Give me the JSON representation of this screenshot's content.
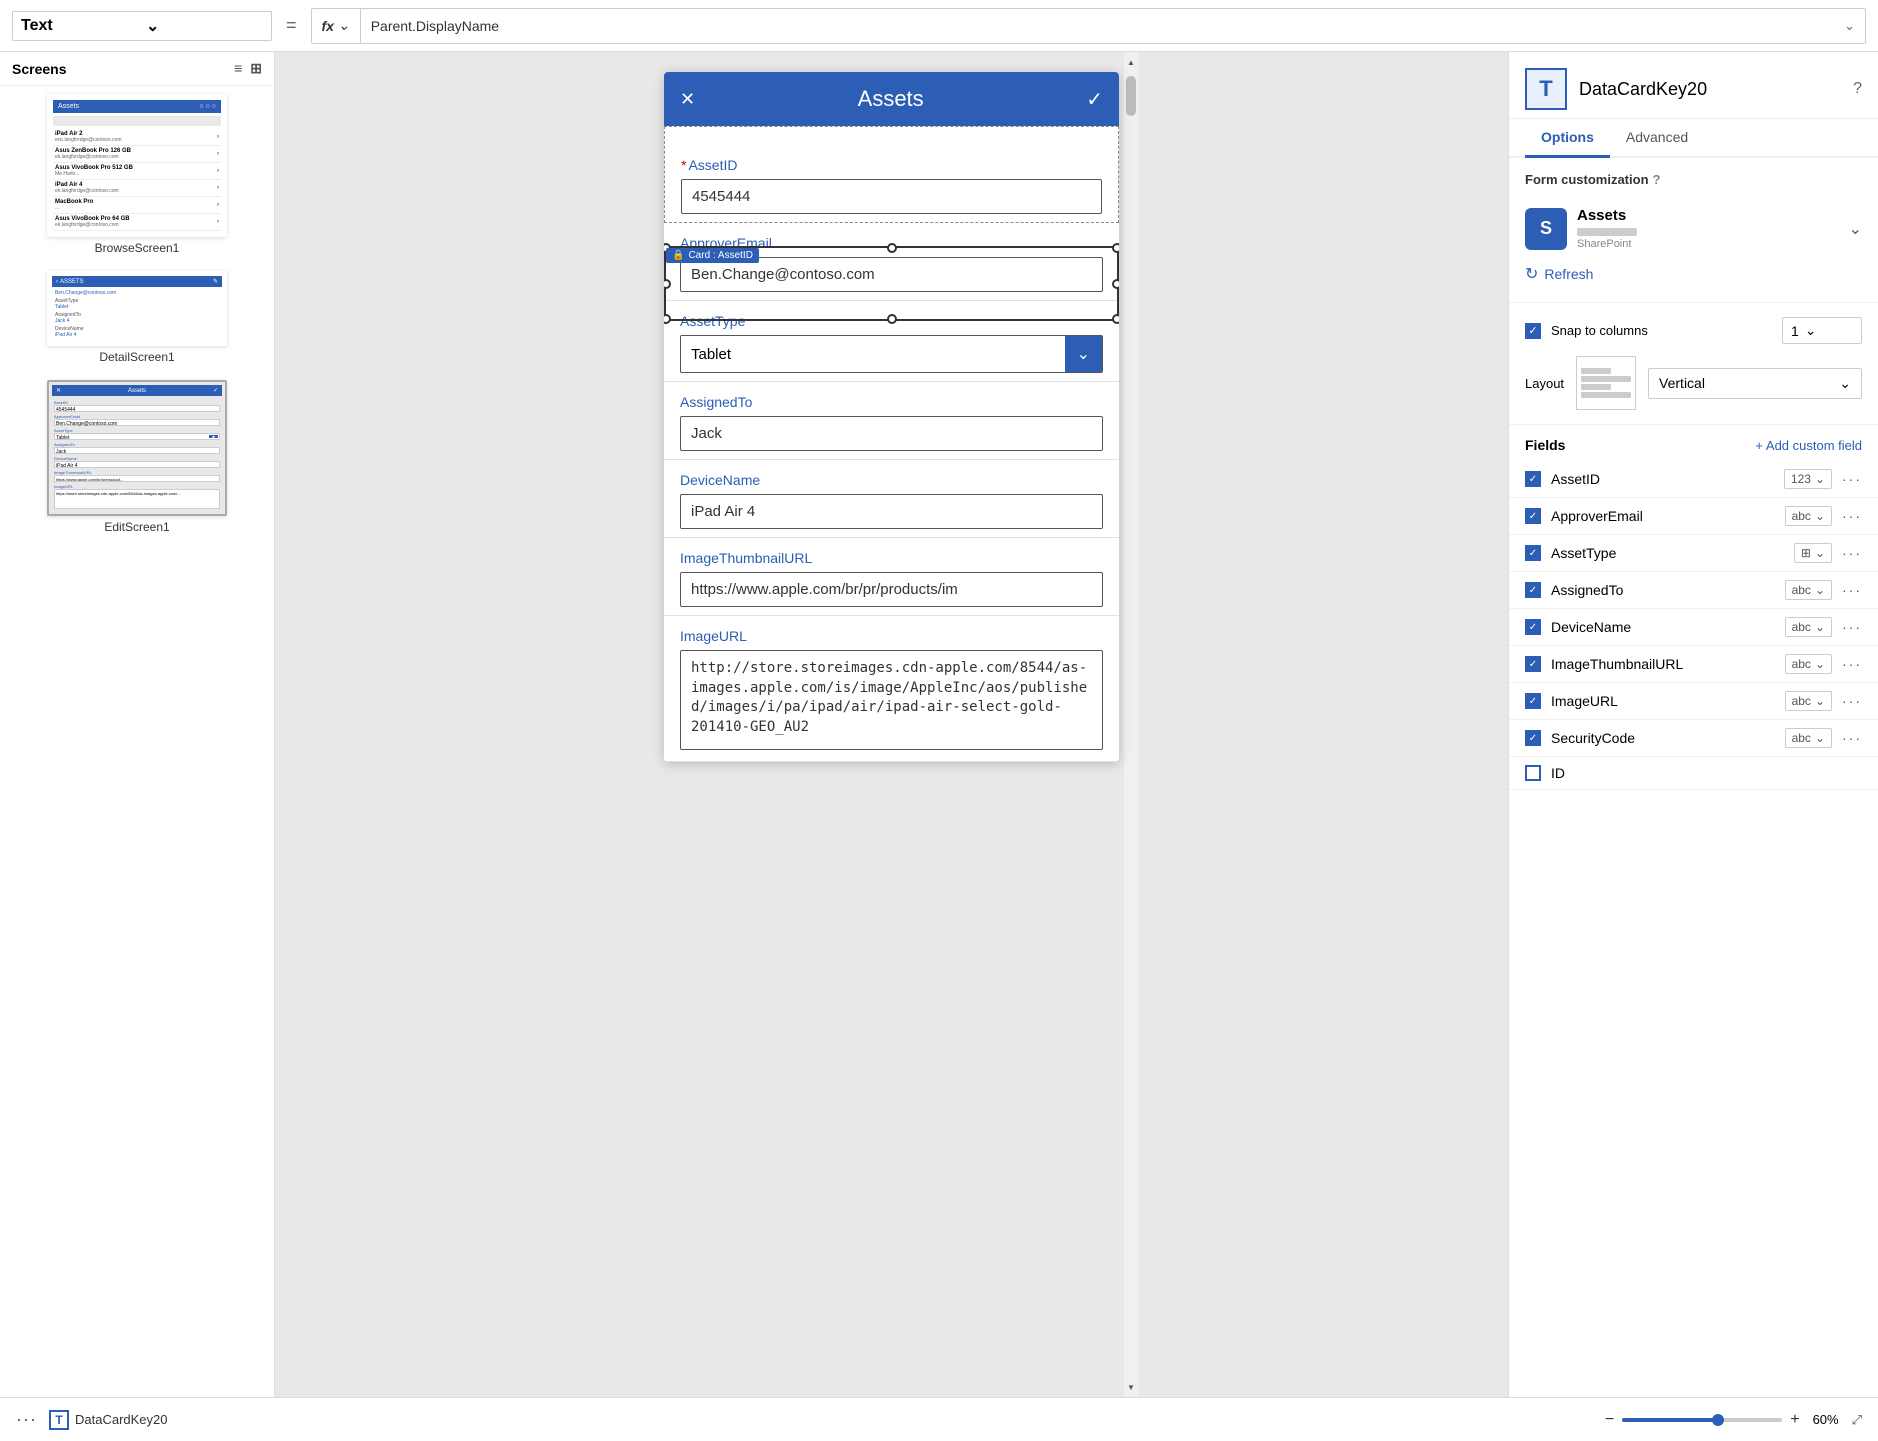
{
  "toolbar": {
    "dropdown_label": "Text",
    "equals_sign": "=",
    "fx_symbol": "fx",
    "formula": "Parent.DisplayName",
    "chevron": "⌄"
  },
  "screens_panel": {
    "title": "Screens",
    "items": [
      {
        "label": "BrowseScreen1"
      },
      {
        "label": "DetailScreen1"
      },
      {
        "label": "EditScreen1"
      }
    ]
  },
  "phone": {
    "header_title": "Assets",
    "close_icon": "✕",
    "check_icon": "✓",
    "card_badge": "Card : AssetID",
    "lock_icon": "🔒",
    "fields": [
      {
        "label": "AssetID",
        "required": true,
        "value": "4545444",
        "type": "text"
      },
      {
        "label": "ApproverEmail",
        "required": false,
        "value": "Ben.Change@contoso.com",
        "type": "text"
      },
      {
        "label": "AssetType",
        "required": false,
        "value": "Tablet",
        "type": "dropdown"
      },
      {
        "label": "AssignedTo",
        "required": false,
        "value": "Jack",
        "type": "text"
      },
      {
        "label": "DeviceName",
        "required": false,
        "value": "iPad Air 4",
        "type": "text"
      },
      {
        "label": "ImageThumbnailURL",
        "required": false,
        "value": "https://www.apple.com/br/pr/products/im",
        "type": "text"
      },
      {
        "label": "ImageURL",
        "required": false,
        "value": "http://store.storeimages.cdn-apple.com/8544/as-images.apple.com/is/image/AppleInc/aos/published/images/i/pa/ipad/air/ipad-air-select-gold-201410-GEO_AU2",
        "type": "textarea"
      }
    ]
  },
  "right_panel": {
    "title": "DataCardKey20",
    "help_icon": "?",
    "tabs": [
      "Options",
      "Advanced"
    ],
    "active_tab": "Options",
    "form_customization_label": "Form customization",
    "data_source": {
      "name": "Assets",
      "sub": "SharePoint",
      "icon_letter": "S"
    },
    "refresh_label": "Refresh",
    "snap_to_columns_label": "Snap to columns",
    "columns_value": "1",
    "layout_label": "Layout",
    "layout_value": "Vertical",
    "fields_title": "Fields",
    "add_custom_field_label": "+ Add custom field",
    "fields": [
      {
        "name": "AssetID",
        "checked": true,
        "type_icon": "123",
        "has_chevron": true
      },
      {
        "name": "ApproverEmail",
        "checked": true,
        "type_icon": "abc",
        "has_chevron": true
      },
      {
        "name": "AssetType",
        "checked": true,
        "type_icon": "⊞",
        "has_chevron": true
      },
      {
        "name": "AssignedTo",
        "checked": true,
        "type_icon": "abc",
        "has_chevron": true
      },
      {
        "name": "DeviceName",
        "checked": true,
        "type_icon": "abc",
        "has_chevron": true
      },
      {
        "name": "ImageThumbnailURL",
        "checked": true,
        "type_icon": "abc",
        "has_chevron": true
      },
      {
        "name": "ImageURL",
        "checked": true,
        "type_icon": "abc",
        "has_chevron": true
      },
      {
        "name": "SecurityCode",
        "checked": true,
        "type_icon": "abc",
        "has_chevron": true
      },
      {
        "name": "ID",
        "checked": false,
        "type_icon": "",
        "has_chevron": false
      }
    ]
  },
  "bottom_bar": {
    "screen_icon": "T",
    "screen_label": "DataCardKey20",
    "zoom_minus": "−",
    "zoom_plus": "+",
    "zoom_level": "60%"
  }
}
